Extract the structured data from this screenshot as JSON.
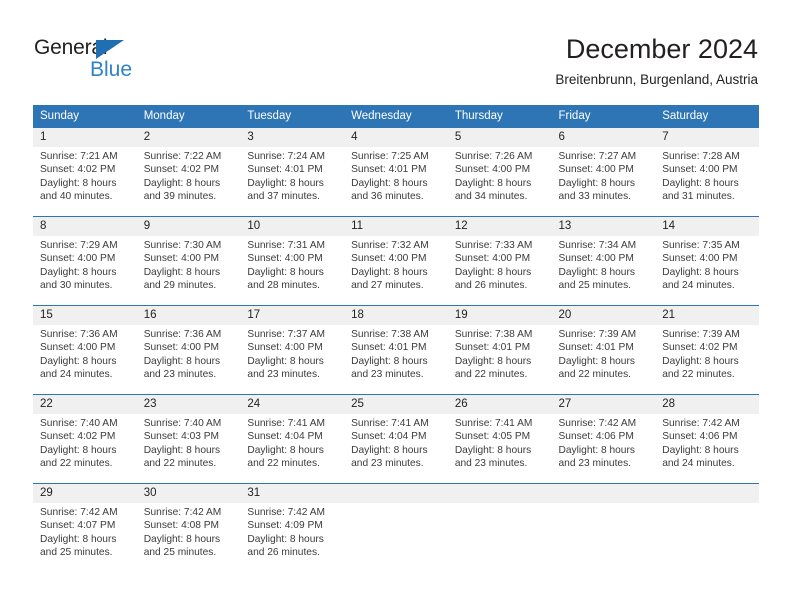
{
  "brand": {
    "general": "General",
    "blue": "Blue",
    "triangle_color": "#1f6fb2",
    "blue_color": "#2e83c8"
  },
  "header": {
    "title": "December 2024",
    "subtitle": "Breitenbrunn, Burgenland, Austria"
  },
  "theme": {
    "header_blue": "#2e75b6",
    "daynum_band": "#f0f0f0",
    "text": "#231f20"
  },
  "weekday_headers": [
    "Sunday",
    "Monday",
    "Tuesday",
    "Wednesday",
    "Thursday",
    "Friday",
    "Saturday"
  ],
  "weeks": [
    [
      {
        "day": "1",
        "sunrise": "Sunrise: 7:21 AM",
        "sunset": "Sunset: 4:02 PM",
        "daylight1": "Daylight: 8 hours",
        "daylight2": "and 40 minutes."
      },
      {
        "day": "2",
        "sunrise": "Sunrise: 7:22 AM",
        "sunset": "Sunset: 4:02 PM",
        "daylight1": "Daylight: 8 hours",
        "daylight2": "and 39 minutes."
      },
      {
        "day": "3",
        "sunrise": "Sunrise: 7:24 AM",
        "sunset": "Sunset: 4:01 PM",
        "daylight1": "Daylight: 8 hours",
        "daylight2": "and 37 minutes."
      },
      {
        "day": "4",
        "sunrise": "Sunrise: 7:25 AM",
        "sunset": "Sunset: 4:01 PM",
        "daylight1": "Daylight: 8 hours",
        "daylight2": "and 36 minutes."
      },
      {
        "day": "5",
        "sunrise": "Sunrise: 7:26 AM",
        "sunset": "Sunset: 4:00 PM",
        "daylight1": "Daylight: 8 hours",
        "daylight2": "and 34 minutes."
      },
      {
        "day": "6",
        "sunrise": "Sunrise: 7:27 AM",
        "sunset": "Sunset: 4:00 PM",
        "daylight1": "Daylight: 8 hours",
        "daylight2": "and 33 minutes."
      },
      {
        "day": "7",
        "sunrise": "Sunrise: 7:28 AM",
        "sunset": "Sunset: 4:00 PM",
        "daylight1": "Daylight: 8 hours",
        "daylight2": "and 31 minutes."
      }
    ],
    [
      {
        "day": "8",
        "sunrise": "Sunrise: 7:29 AM",
        "sunset": "Sunset: 4:00 PM",
        "daylight1": "Daylight: 8 hours",
        "daylight2": "and 30 minutes."
      },
      {
        "day": "9",
        "sunrise": "Sunrise: 7:30 AM",
        "sunset": "Sunset: 4:00 PM",
        "daylight1": "Daylight: 8 hours",
        "daylight2": "and 29 minutes."
      },
      {
        "day": "10",
        "sunrise": "Sunrise: 7:31 AM",
        "sunset": "Sunset: 4:00 PM",
        "daylight1": "Daylight: 8 hours",
        "daylight2": "and 28 minutes."
      },
      {
        "day": "11",
        "sunrise": "Sunrise: 7:32 AM",
        "sunset": "Sunset: 4:00 PM",
        "daylight1": "Daylight: 8 hours",
        "daylight2": "and 27 minutes."
      },
      {
        "day": "12",
        "sunrise": "Sunrise: 7:33 AM",
        "sunset": "Sunset: 4:00 PM",
        "daylight1": "Daylight: 8 hours",
        "daylight2": "and 26 minutes."
      },
      {
        "day": "13",
        "sunrise": "Sunrise: 7:34 AM",
        "sunset": "Sunset: 4:00 PM",
        "daylight1": "Daylight: 8 hours",
        "daylight2": "and 25 minutes."
      },
      {
        "day": "14",
        "sunrise": "Sunrise: 7:35 AM",
        "sunset": "Sunset: 4:00 PM",
        "daylight1": "Daylight: 8 hours",
        "daylight2": "and 24 minutes."
      }
    ],
    [
      {
        "day": "15",
        "sunrise": "Sunrise: 7:36 AM",
        "sunset": "Sunset: 4:00 PM",
        "daylight1": "Daylight: 8 hours",
        "daylight2": "and 24 minutes."
      },
      {
        "day": "16",
        "sunrise": "Sunrise: 7:36 AM",
        "sunset": "Sunset: 4:00 PM",
        "daylight1": "Daylight: 8 hours",
        "daylight2": "and 23 minutes."
      },
      {
        "day": "17",
        "sunrise": "Sunrise: 7:37 AM",
        "sunset": "Sunset: 4:00 PM",
        "daylight1": "Daylight: 8 hours",
        "daylight2": "and 23 minutes."
      },
      {
        "day": "18",
        "sunrise": "Sunrise: 7:38 AM",
        "sunset": "Sunset: 4:01 PM",
        "daylight1": "Daylight: 8 hours",
        "daylight2": "and 23 minutes."
      },
      {
        "day": "19",
        "sunrise": "Sunrise: 7:38 AM",
        "sunset": "Sunset: 4:01 PM",
        "daylight1": "Daylight: 8 hours",
        "daylight2": "and 22 minutes."
      },
      {
        "day": "20",
        "sunrise": "Sunrise: 7:39 AM",
        "sunset": "Sunset: 4:01 PM",
        "daylight1": "Daylight: 8 hours",
        "daylight2": "and 22 minutes."
      },
      {
        "day": "21",
        "sunrise": "Sunrise: 7:39 AM",
        "sunset": "Sunset: 4:02 PM",
        "daylight1": "Daylight: 8 hours",
        "daylight2": "and 22 minutes."
      }
    ],
    [
      {
        "day": "22",
        "sunrise": "Sunrise: 7:40 AM",
        "sunset": "Sunset: 4:02 PM",
        "daylight1": "Daylight: 8 hours",
        "daylight2": "and 22 minutes."
      },
      {
        "day": "23",
        "sunrise": "Sunrise: 7:40 AM",
        "sunset": "Sunset: 4:03 PM",
        "daylight1": "Daylight: 8 hours",
        "daylight2": "and 22 minutes."
      },
      {
        "day": "24",
        "sunrise": "Sunrise: 7:41 AM",
        "sunset": "Sunset: 4:04 PM",
        "daylight1": "Daylight: 8 hours",
        "daylight2": "and 22 minutes."
      },
      {
        "day": "25",
        "sunrise": "Sunrise: 7:41 AM",
        "sunset": "Sunset: 4:04 PM",
        "daylight1": "Daylight: 8 hours",
        "daylight2": "and 23 minutes."
      },
      {
        "day": "26",
        "sunrise": "Sunrise: 7:41 AM",
        "sunset": "Sunset: 4:05 PM",
        "daylight1": "Daylight: 8 hours",
        "daylight2": "and 23 minutes."
      },
      {
        "day": "27",
        "sunrise": "Sunrise: 7:42 AM",
        "sunset": "Sunset: 4:06 PM",
        "daylight1": "Daylight: 8 hours",
        "daylight2": "and 23 minutes."
      },
      {
        "day": "28",
        "sunrise": "Sunrise: 7:42 AM",
        "sunset": "Sunset: 4:06 PM",
        "daylight1": "Daylight: 8 hours",
        "daylight2": "and 24 minutes."
      }
    ],
    [
      {
        "day": "29",
        "sunrise": "Sunrise: 7:42 AM",
        "sunset": "Sunset: 4:07 PM",
        "daylight1": "Daylight: 8 hours",
        "daylight2": "and 25 minutes."
      },
      {
        "day": "30",
        "sunrise": "Sunrise: 7:42 AM",
        "sunset": "Sunset: 4:08 PM",
        "daylight1": "Daylight: 8 hours",
        "daylight2": "and 25 minutes."
      },
      {
        "day": "31",
        "sunrise": "Sunrise: 7:42 AM",
        "sunset": "Sunset: 4:09 PM",
        "daylight1": "Daylight: 8 hours",
        "daylight2": "and 26 minutes."
      },
      {
        "day": "",
        "sunrise": "",
        "sunset": "",
        "daylight1": "",
        "daylight2": ""
      },
      {
        "day": "",
        "sunrise": "",
        "sunset": "",
        "daylight1": "",
        "daylight2": ""
      },
      {
        "day": "",
        "sunrise": "",
        "sunset": "",
        "daylight1": "",
        "daylight2": ""
      },
      {
        "day": "",
        "sunrise": "",
        "sunset": "",
        "daylight1": "",
        "daylight2": ""
      }
    ]
  ]
}
